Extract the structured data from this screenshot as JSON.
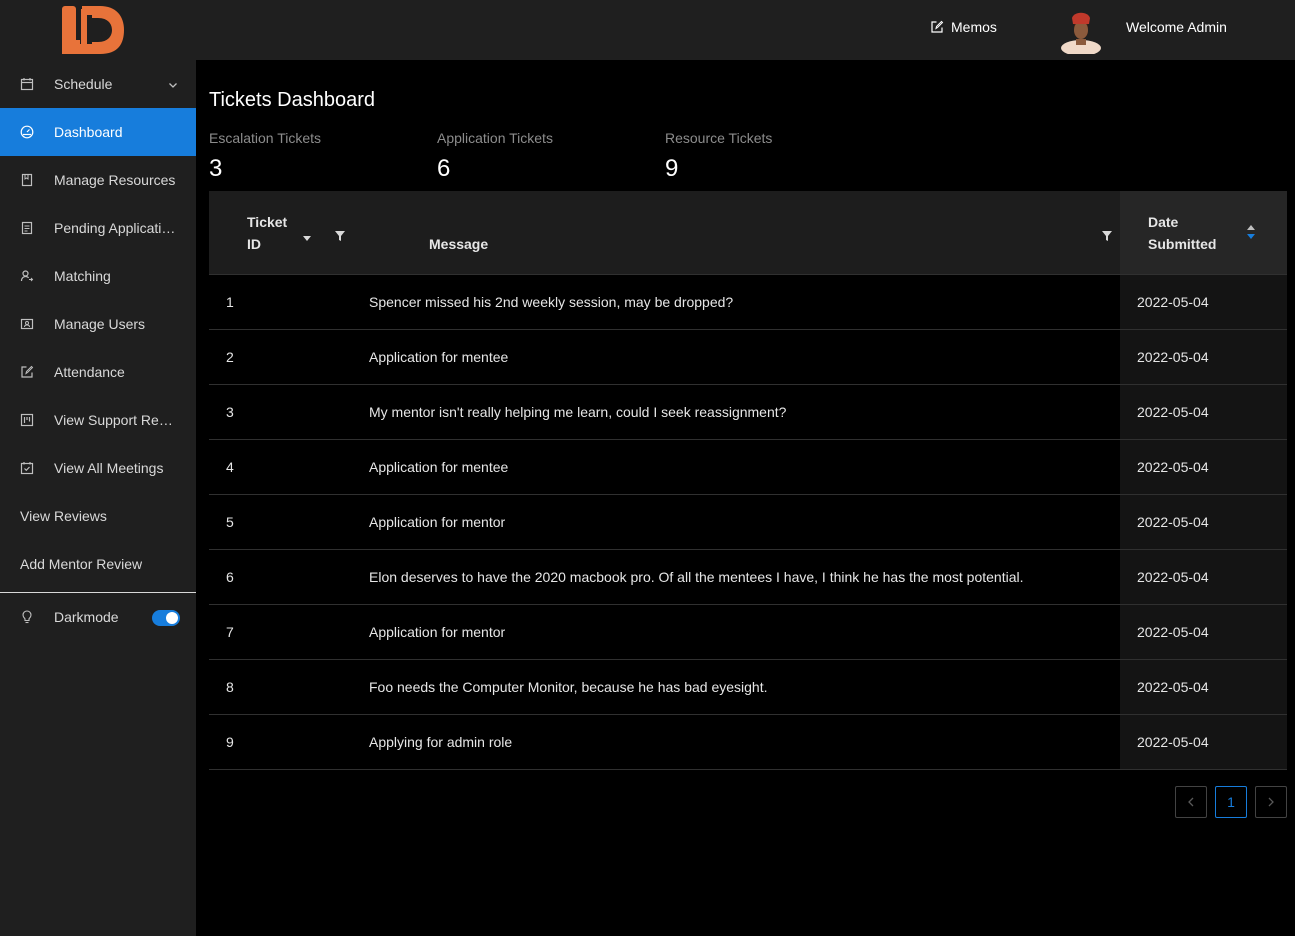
{
  "header": {
    "memos_label": "Memos",
    "welcome_text": "Welcome Admin"
  },
  "sidebar": {
    "items": [
      {
        "label": "Schedule",
        "icon": "calendar-icon"
      },
      {
        "label": "Dashboard",
        "icon": "dashboard-icon"
      },
      {
        "label": "Manage Resources",
        "icon": "book-icon"
      },
      {
        "label": "Pending Applications",
        "icon": "file-icon"
      },
      {
        "label": "Matching",
        "icon": "user-switch-icon"
      },
      {
        "label": "Manage Users",
        "icon": "idcard-icon"
      },
      {
        "label": "Attendance",
        "icon": "edit-icon"
      },
      {
        "label": "View Support Requests",
        "icon": "project-icon"
      },
      {
        "label": "View All Meetings",
        "icon": "carry-out-icon"
      },
      {
        "label": "View Reviews"
      },
      {
        "label": "Add Mentor Review"
      }
    ],
    "darkmode_label": "Darkmode",
    "darkmode_on": true
  },
  "main": {
    "title": "Tickets Dashboard",
    "stats": [
      {
        "label": "Escalation Tickets",
        "value": "3"
      },
      {
        "label": "Application Tickets",
        "value": "6"
      },
      {
        "label": "Resource Tickets",
        "value": "9"
      }
    ],
    "table": {
      "col_ticket_line1": "Ticket",
      "col_ticket_line2": "ID",
      "col_message": "Message",
      "col_date_line1": "Date",
      "col_date_line2": "Submitted",
      "rows": [
        {
          "id": "1",
          "message": "Spencer missed his 2nd weekly session, may be dropped?",
          "date": "2022-05-04"
        },
        {
          "id": "2",
          "message": "Application for mentee",
          "date": "2022-05-04"
        },
        {
          "id": "3",
          "message": "My mentor isn't really helping me learn, could I seek reassignment?",
          "date": "2022-05-04"
        },
        {
          "id": "4",
          "message": "Application for mentee",
          "date": "2022-05-04"
        },
        {
          "id": "5",
          "message": "Application for mentor",
          "date": "2022-05-04"
        },
        {
          "id": "6",
          "message": "Elon deserves to have the 2020 macbook pro. Of all the mentees I have, I think he has the most potential.",
          "date": "2022-05-04"
        },
        {
          "id": "7",
          "message": "Application for mentor",
          "date": "2022-05-04"
        },
        {
          "id": "8",
          "message": "Foo needs the Computer Monitor, because he has bad eyesight.",
          "date": "2022-05-04"
        },
        {
          "id": "9",
          "message": "Applying for admin role",
          "date": "2022-05-04"
        }
      ]
    },
    "pagination": {
      "current": "1"
    }
  },
  "colors": {
    "accent": "#177ddc",
    "logo": "#e8733a",
    "sidebar_bg": "#1f1f1f",
    "page_bg": "#000000"
  }
}
